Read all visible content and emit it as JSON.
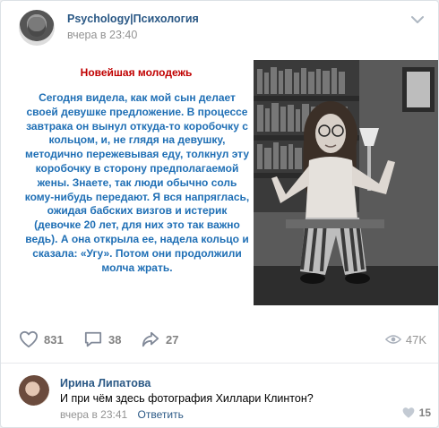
{
  "post": {
    "group_name": "Psychology|Психология",
    "time": "вчера в 23:40"
  },
  "image_text": {
    "title": "Новейшая молодежь",
    "body": "Сегодня видела, как мой сын делает своей девушке предложение. В процессе завтрака он вынул откуда-то коробочку с кольцом, и, не глядя на девушку, методично пережевывая еду, толкнул эту коробочку в сторону предполагаемой жены. Знаете, так люди обычно соль кому-нибудь передают. Я вся напряглась, ожидая бабских визгов и истерик (девочке 20 лет, для них это так важно ведь). А она открыла ее, надела кольцо и сказала: «Угу». Потом они продолжили молча жрать."
  },
  "actions": {
    "likes": "831",
    "comments": "38",
    "shares": "27",
    "views": "47K"
  },
  "comment": {
    "author": "Ирина Липатова",
    "text": "И при чём здесь фотография Хиллари Клинтон?",
    "time": "вчера в 23:41",
    "reply_label": "Ответить",
    "likes": "15"
  },
  "colors": {
    "link_blue": "#2a5885",
    "title_red": "#c00000",
    "body_blue": "#1f6fb5",
    "muted": "#939393"
  }
}
